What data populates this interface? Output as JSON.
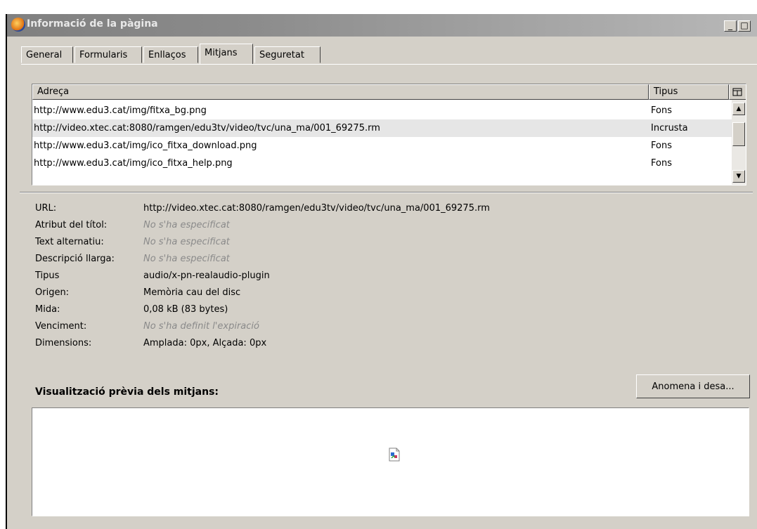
{
  "window": {
    "title": "Informació de la pàgina",
    "minimize_label": "_",
    "maximize_label": "□"
  },
  "tabs": [
    {
      "label": "General",
      "active": false
    },
    {
      "label": "Formularis",
      "active": false
    },
    {
      "label": "Enllaços",
      "active": false
    },
    {
      "label": "Mitjans",
      "active": true
    },
    {
      "label": "Seguretat",
      "active": false
    }
  ],
  "media_table": {
    "columns": [
      "Adreça",
      "Tipus"
    ],
    "rows": [
      {
        "address": "http://www.edu3.cat/img/fitxa_bg.png",
        "type": "Fons",
        "selected": false
      },
      {
        "address": "http://video.xtec.cat:8080/ramgen/edu3tv/video/tvc/una_ma/001_69275.rm",
        "type": "Incrusta",
        "selected": true
      },
      {
        "address": "http://www.edu3.cat/img/ico_fitxa_download.png",
        "type": "Fons",
        "selected": false
      },
      {
        "address": "http://www.edu3.cat/img/ico_fitxa_help.png",
        "type": "Fons",
        "selected": false
      }
    ]
  },
  "properties": [
    {
      "label": "URL:",
      "value": "http://video.xtec.cat:8080/ramgen/edu3tv/video/tvc/una_ma/001_69275.rm",
      "empty": false
    },
    {
      "label": "Atribut del títol:",
      "value": "No s'ha especificat",
      "empty": true
    },
    {
      "label": "Text alternatiu:",
      "value": "No s'ha especificat",
      "empty": true
    },
    {
      "label": "Descripció llarga:",
      "value": "No s'ha especificat",
      "empty": true
    },
    {
      "label": "Tipus",
      "value": "audio/x-pn-realaudio-plugin",
      "empty": false
    },
    {
      "label": "Origen:",
      "value": "Memòria cau del disc",
      "empty": false
    },
    {
      "label": "Mida:",
      "value": "0,08 kB (83 bytes)",
      "empty": false
    },
    {
      "label": "Venciment:",
      "value": "No s'ha definit l'expiració",
      "empty": true
    },
    {
      "label": "Dimensions:",
      "value": "Amplada: 0px, Alçada: 0px",
      "empty": false
    }
  ],
  "preview": {
    "label": "Visualització prèvia dels mitjans:",
    "save_button": "Anomena i desa..."
  }
}
